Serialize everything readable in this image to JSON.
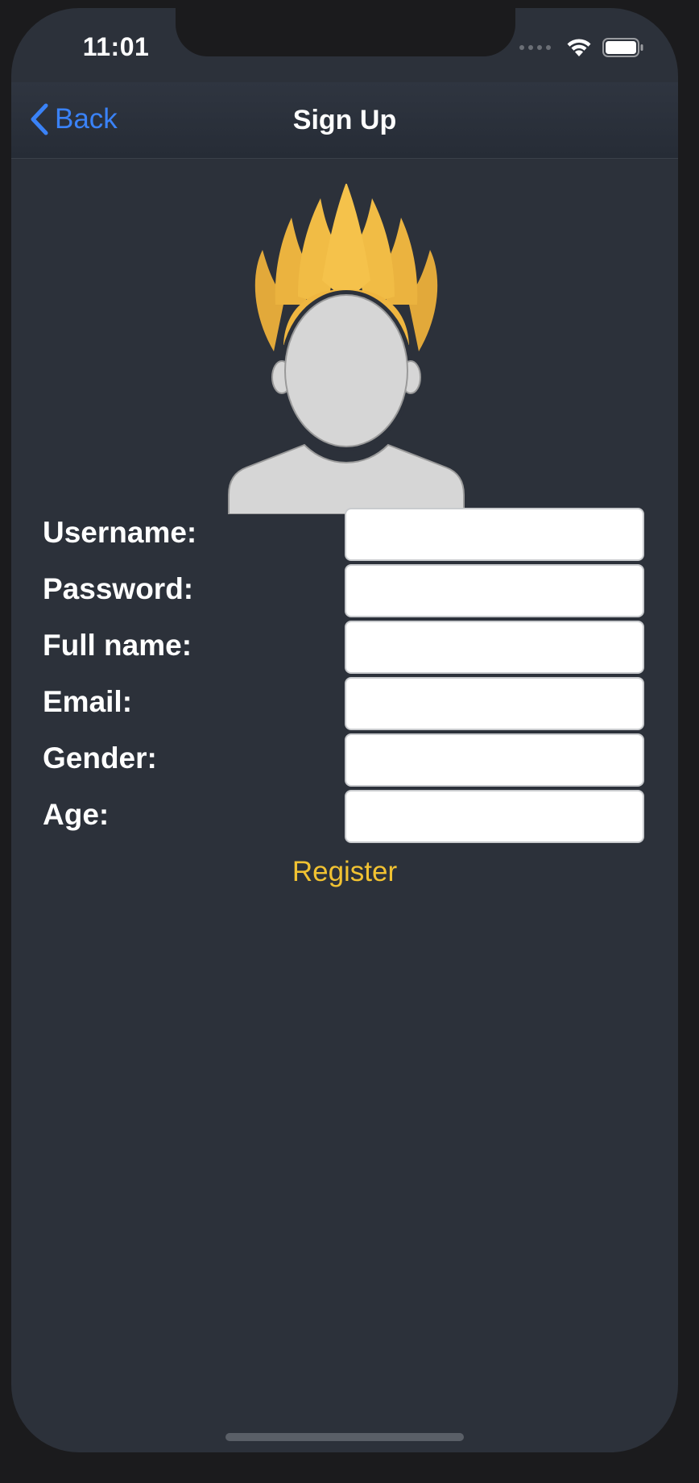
{
  "status_bar": {
    "time": "11:01",
    "icons": [
      "cellular-signal-icon",
      "wifi-icon",
      "battery-icon"
    ]
  },
  "nav": {
    "back_label": "Back",
    "title": "Sign Up"
  },
  "avatar": {
    "icon": "user-avatar-icon",
    "hair_color": "#f0b73e",
    "face_color": "#d6d6d6"
  },
  "form": {
    "fields": [
      {
        "label": "Username:",
        "value": "",
        "placeholder": ""
      },
      {
        "label": "Password:",
        "value": "",
        "placeholder": ""
      },
      {
        "label": "Full name:",
        "value": "",
        "placeholder": ""
      },
      {
        "label": "Email:",
        "value": "",
        "placeholder": ""
      },
      {
        "label": "Gender:",
        "value": "",
        "placeholder": ""
      },
      {
        "label": "Age:",
        "value": "",
        "placeholder": ""
      }
    ],
    "register_label": "Register"
  },
  "colors": {
    "background": "#2c313a",
    "accent_blue": "#3a82f7",
    "accent_yellow": "#f1c232"
  }
}
